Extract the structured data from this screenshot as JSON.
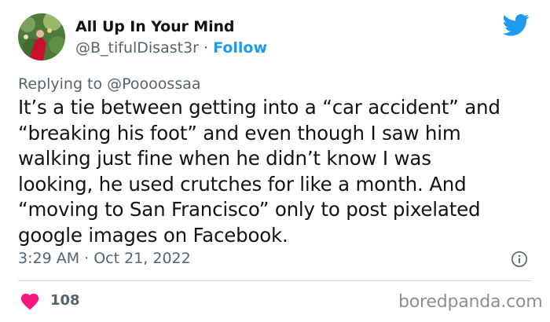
{
  "author": {
    "display_name": "All Up In Your Mind",
    "handle": "@B_tifulDisast3r",
    "separator": " · ",
    "follow_label": "Follow"
  },
  "reply": {
    "prefix": "Replying to ",
    "mention": "@Poooossaa"
  },
  "tweet": {
    "lines": [
      "It’s a tie between getting into a “car accident” and",
      "“breaking his foot” and even though I saw him",
      "walking just fine when he didn’t know I was",
      "looking, he used crutches for like a month. And",
      "“moving to San Francisco” only to post pixelated",
      "google images on Facebook."
    ],
    "timestamp": "3:29 AM · Oct 21, 2022",
    "like_count": "108"
  },
  "watermark": "boredpanda.com",
  "colors": {
    "accent": "#1d9bf0",
    "heart": "#f91880",
    "secondary_text": "#536471"
  },
  "icons": {
    "logo": "twitter-bird-icon",
    "info": "info-icon",
    "like": "heart-icon"
  }
}
